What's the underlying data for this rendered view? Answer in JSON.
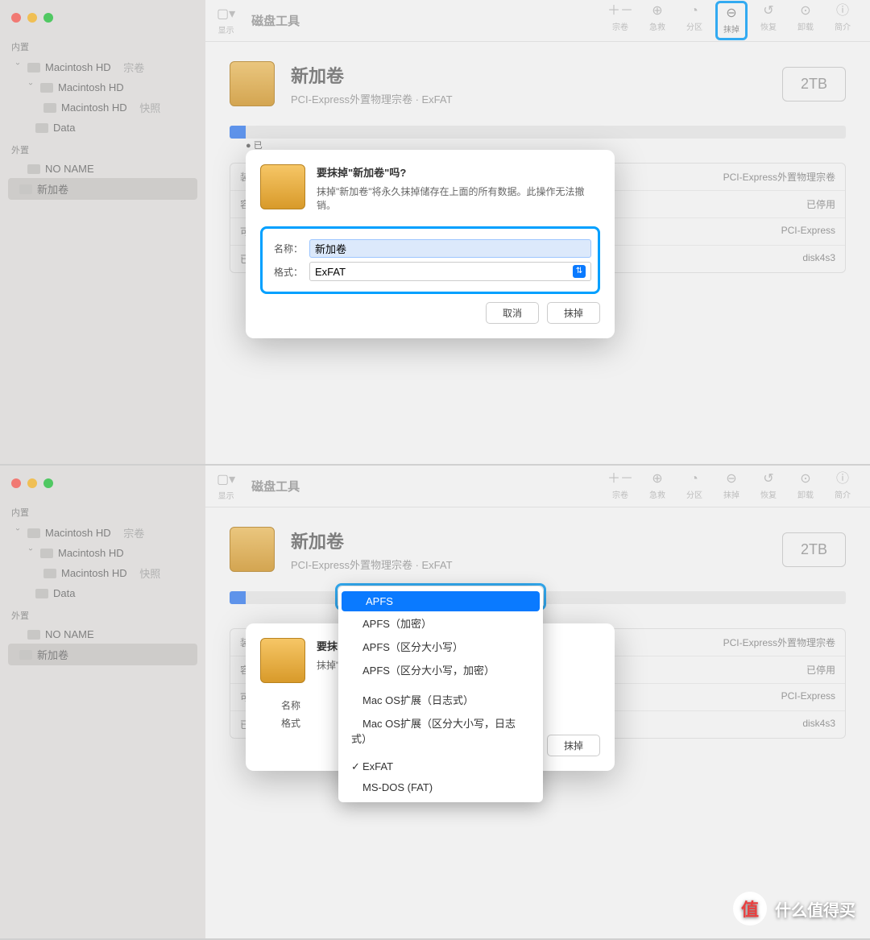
{
  "app": {
    "title": "磁盘工具",
    "display_label": "显示"
  },
  "toolbar": {
    "buttons": [
      {
        "icon": "＋－",
        "label": "宗卷"
      },
      {
        "icon": "⊕",
        "label": "急救"
      },
      {
        "icon": "◔",
        "label": "分区"
      },
      {
        "icon": "⊖",
        "label": "抹掉"
      },
      {
        "icon": "↺",
        "label": "恢复"
      },
      {
        "icon": "⊙",
        "label": "卸载"
      },
      {
        "icon": "ⓘ",
        "label": "简介"
      }
    ]
  },
  "sidebar": {
    "internal_label": "内置",
    "external_label": "外置",
    "items_internal": [
      {
        "label": "Macintosh HD",
        "suffix": "宗卷"
      },
      {
        "label": "Macintosh HD"
      },
      {
        "label": "Macintosh HD",
        "suffix": "快照"
      },
      {
        "label": "Data"
      }
    ],
    "items_external": [
      {
        "label": "NO NAME"
      },
      {
        "label": "新加卷",
        "selected": true
      }
    ]
  },
  "volume": {
    "name": "新加卷",
    "subtitle": "PCI-Express外置物理宗卷 · ExFAT",
    "capacity": "2TB",
    "usage_marker": "已"
  },
  "info_rows": [
    {
      "k": "装",
      "v": "PCI-Express外置物理宗卷"
    },
    {
      "k": "容",
      "v": "已停用"
    },
    {
      "k": "可",
      "v": "PCI-Express"
    },
    {
      "k": "已",
      "v": "disk4s3"
    }
  ],
  "modal": {
    "title": "要抹掉\"新加卷\"吗?",
    "message": "抹掉\"新加卷\"将永久抹掉储存在上面的所有数据。此操作无法撤销。",
    "name_label": "名称：",
    "name_value": "新加卷",
    "format_label": "格式：",
    "format_value": "ExFAT",
    "cancel": "取消",
    "confirm": "抹掉"
  },
  "dropdown": {
    "options": [
      "APFS",
      "APFS（加密）",
      "APFS（区分大小写）",
      "APFS（区分大小写，加密）",
      "Mac OS扩展（日志式）",
      "Mac OS扩展（区分大小写，日志式）",
      "ExFAT",
      "MS-DOS (FAT)"
    ],
    "selected_index": 0,
    "checked_index": 6
  },
  "watermark": "什么值得买"
}
